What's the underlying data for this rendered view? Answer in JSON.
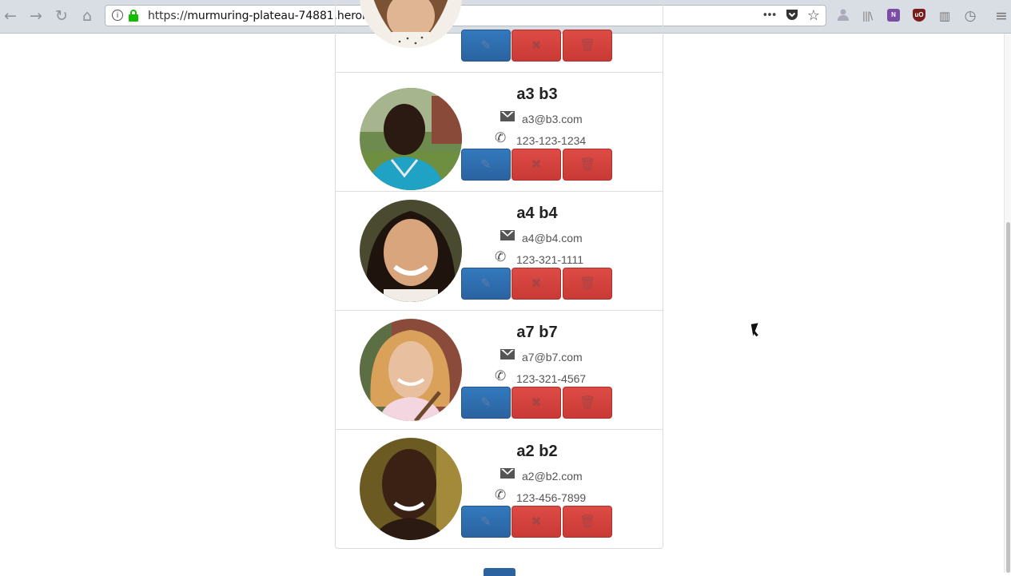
{
  "browser": {
    "url_prefix": "https://",
    "url_host": "murmuring-plateau-74881.herokuapp.com",
    "icons": {
      "back": "back-arrow-icon",
      "forward": "forward-arrow-icon",
      "reload": "reload-icon",
      "home": "home-icon",
      "info": "info-icon",
      "lock": "lock-icon",
      "more": "ellipsis-icon",
      "pocket": "pocket-icon",
      "bookmark": "star-icon",
      "library": "library-icon",
      "onenote": "onenote-icon",
      "ublock": "ublock-icon",
      "sidebar": "sidebar-icon",
      "history": "clock-icon",
      "menu": "hamburger-menu-icon"
    },
    "glyphs": {
      "back": "←",
      "forward": "→",
      "reload": "↻",
      "home": "⌂",
      "info": "i",
      "more": "•••",
      "bookmark": "☆",
      "library": "|||\\",
      "onenote": "N",
      "ublock": "uO",
      "sidebar": "▥",
      "history": "◷",
      "menu": "≡"
    }
  },
  "contacts": [
    {
      "name": "",
      "email": "",
      "phone": "",
      "avatar": "partial-avatar"
    },
    {
      "name": "a3 b3",
      "email": "a3@b3.com",
      "phone": "123-123-1234"
    },
    {
      "name": "a4 b4",
      "email": "a4@b4.com",
      "phone": "123-321-1111"
    },
    {
      "name": "a7 b7",
      "email": "a7@b7.com",
      "phone": "123-321-4567"
    },
    {
      "name": "a2 b2",
      "email": "a2@b2.com",
      "phone": "123-456-7899"
    }
  ],
  "buttons": {
    "edit_glyph": "✎",
    "cancel_glyph": "✖",
    "delete_glyph": "🗑"
  },
  "colors": {
    "edit": "#2a63a0",
    "danger": "#c93a36",
    "lock": "#12bc00"
  }
}
